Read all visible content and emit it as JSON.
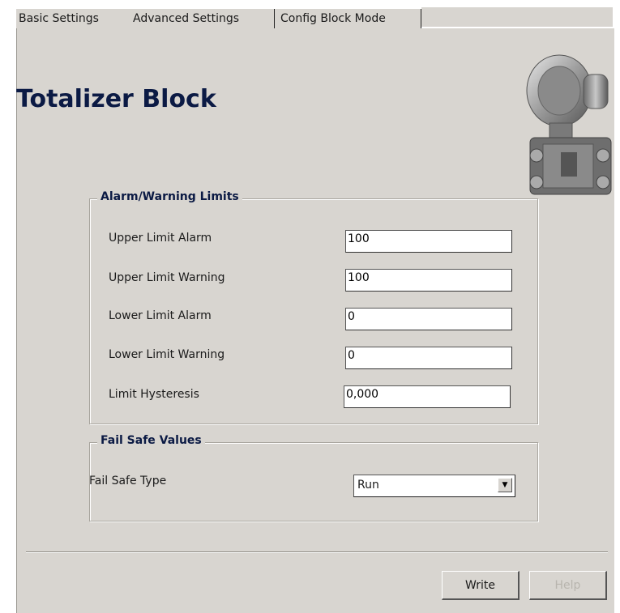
{
  "tabs": [
    {
      "label": "Basic Settings"
    },
    {
      "label": "Advanced Settings"
    },
    {
      "label": "Config Block Mode"
    }
  ],
  "page_title": "Totalizer Block",
  "device_image": "pressure-transmitter-icon",
  "alarm_group": {
    "legend": "Alarm/Warning Limits",
    "fields": [
      {
        "label": "Upper Limit Alarm",
        "value": "100"
      },
      {
        "label": "Upper Limit Warning",
        "value": "100"
      },
      {
        "label": "Lower Limit Alarm",
        "value": "0"
      },
      {
        "label": "Lower Limit Warning",
        "value": "0"
      },
      {
        "label": "Limit Hysteresis",
        "value": "0,000"
      }
    ]
  },
  "failsafe_group": {
    "legend": "Fail Safe Values",
    "type_label": "Fail Safe Type",
    "type_value": "Run"
  },
  "buttons": {
    "write": "Write",
    "help": "Help"
  },
  "colors": {
    "panel": "#d8d5d0",
    "title": "#0b1a44"
  }
}
